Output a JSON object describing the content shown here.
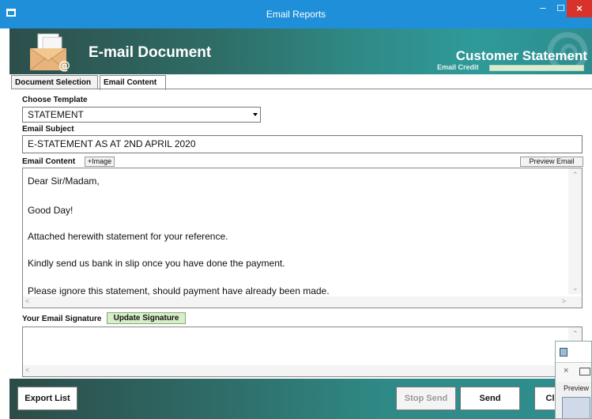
{
  "window": {
    "title": "Email Reports",
    "close_glyph": "×",
    "minimize_glyph": "–"
  },
  "header": {
    "title": "E-mail Document",
    "report_title": "Customer Statement",
    "credit_label": "Email Credit",
    "envelope_glyph": "@"
  },
  "tabs": [
    {
      "label": "Document Selection"
    },
    {
      "label": "Email Content"
    }
  ],
  "form": {
    "template_label": "Choose Template",
    "template_value": "STATEMENT",
    "subject_label": "Email Subject",
    "subject_value": "E-STATEMENT AS AT 2ND APRIL 2020",
    "content_label": "Email Content",
    "image_button": "+Image",
    "preview_button": "Preview Email",
    "content_lines": [
      "Dear Sir/Madam,",
      "Good Day!",
      "Attached herewith statement for your reference.",
      "Kindly send us bank in slip once you have done the payment.",
      "Please ignore this statement, should payment have already been made."
    ],
    "signature_label": "Your Email Signature",
    "update_signature_button": "Update Signature"
  },
  "footer": {
    "export_button": "Export List",
    "stop_button": "Stop Send",
    "send_button": "Send",
    "close_button": "Cl"
  },
  "popup": {
    "close_glyph": "×",
    "label": "Preview"
  },
  "colors": {
    "titlebar": "#1f8fd9",
    "header_dark": "#2d4f4b",
    "header_teal": "#2f9a9a",
    "close_red": "#d9322a",
    "update_signature_bg": "#d6efc8"
  }
}
